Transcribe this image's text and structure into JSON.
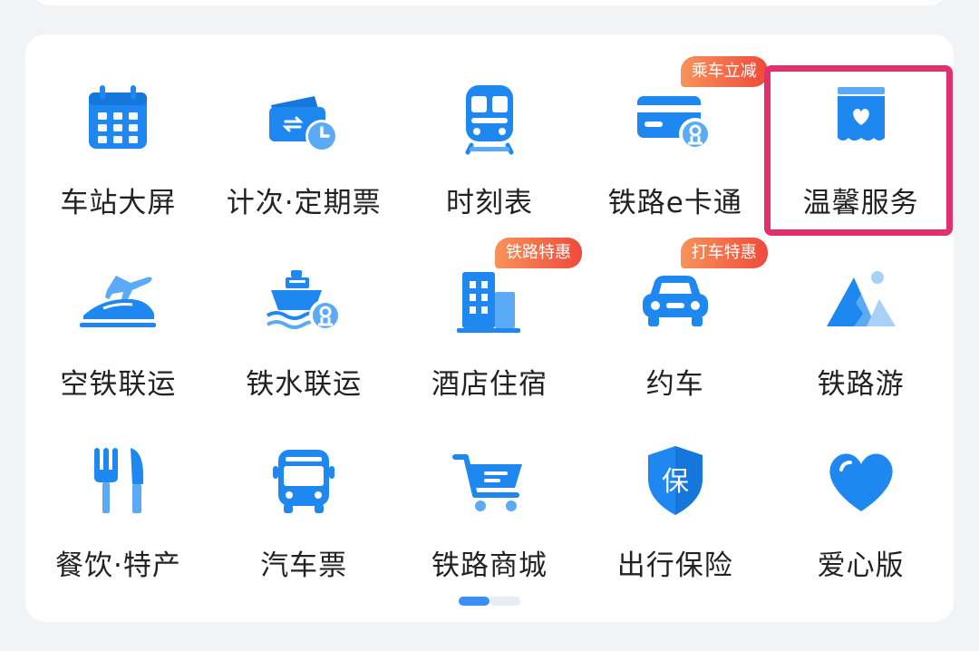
{
  "colors": {
    "accent": "#1e88f0",
    "highlight": "#e0316e",
    "badge": "#f26b43"
  },
  "items": [
    {
      "label": "车站大屏",
      "icon": "calendar-icon"
    },
    {
      "label": "计次·定期票",
      "icon": "ticket-clock-icon"
    },
    {
      "label": "时刻表",
      "icon": "train-icon"
    },
    {
      "label": "铁路e卡通",
      "icon": "card-icon",
      "badge": "乘车立减"
    },
    {
      "label": "温馨服务",
      "icon": "heart-box-icon"
    },
    {
      "label": "空铁联运",
      "icon": "plane-train-icon"
    },
    {
      "label": "铁水联运",
      "icon": "ship-icon"
    },
    {
      "label": "酒店住宿",
      "icon": "hotel-icon",
      "badge": "铁路特惠"
    },
    {
      "label": "约车",
      "icon": "car-icon",
      "badge": "打车特惠"
    },
    {
      "label": "铁路游",
      "icon": "mountain-icon"
    },
    {
      "label": "餐饮·特产",
      "icon": "fork-knife-icon"
    },
    {
      "label": "汽车票",
      "icon": "bus-icon"
    },
    {
      "label": "铁路商城",
      "icon": "cart-icon"
    },
    {
      "label": "出行保险",
      "icon": "shield-icon",
      "shield_text": "保"
    },
    {
      "label": "爱心版",
      "icon": "heart-icon"
    }
  ],
  "pager": {
    "current": 1,
    "total": 2
  }
}
